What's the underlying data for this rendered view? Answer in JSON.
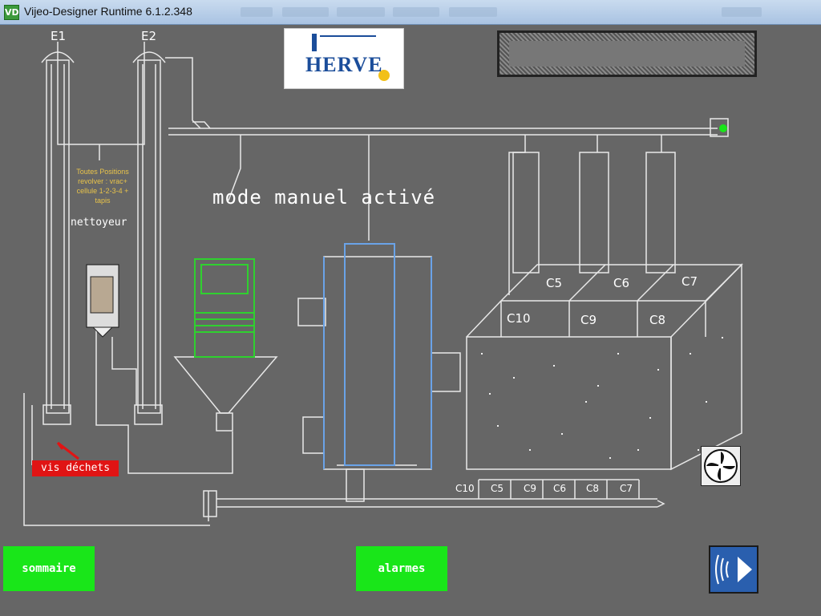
{
  "window": {
    "title": "Vijeo-Designer Runtime 6.1.2.348",
    "app_icon": "VD"
  },
  "elevators": [
    {
      "label": "E1"
    },
    {
      "label": "E2"
    }
  ],
  "logo": {
    "text": "HERVE"
  },
  "note": {
    "line1": "Toutes Positions",
    "line2": "revolver : vrac+",
    "line3": "cellule 1-2-3-4 + tapis"
  },
  "cleaner": {
    "label": "nettoyeur"
  },
  "mode": {
    "text": "mode manuel activé"
  },
  "silo": {
    "cells": [
      "C5",
      "C6",
      "C7",
      "C10",
      "C9",
      "C8"
    ]
  },
  "conveyor": {
    "labels": [
      "C10",
      "C5",
      "C9",
      "C6",
      "C8",
      "C7"
    ]
  },
  "buttons": {
    "waste": "vis déchets",
    "summary": "sommaire",
    "alarms": "alarmes"
  },
  "icons": {
    "fan": "fan-icon",
    "next": "next-page-icon"
  },
  "colors": {
    "background": "#666666",
    "green_button": "#19e619",
    "red_button": "#e01414",
    "truck": "#2fd12f",
    "dryer_blue": "#6aa3e8"
  }
}
